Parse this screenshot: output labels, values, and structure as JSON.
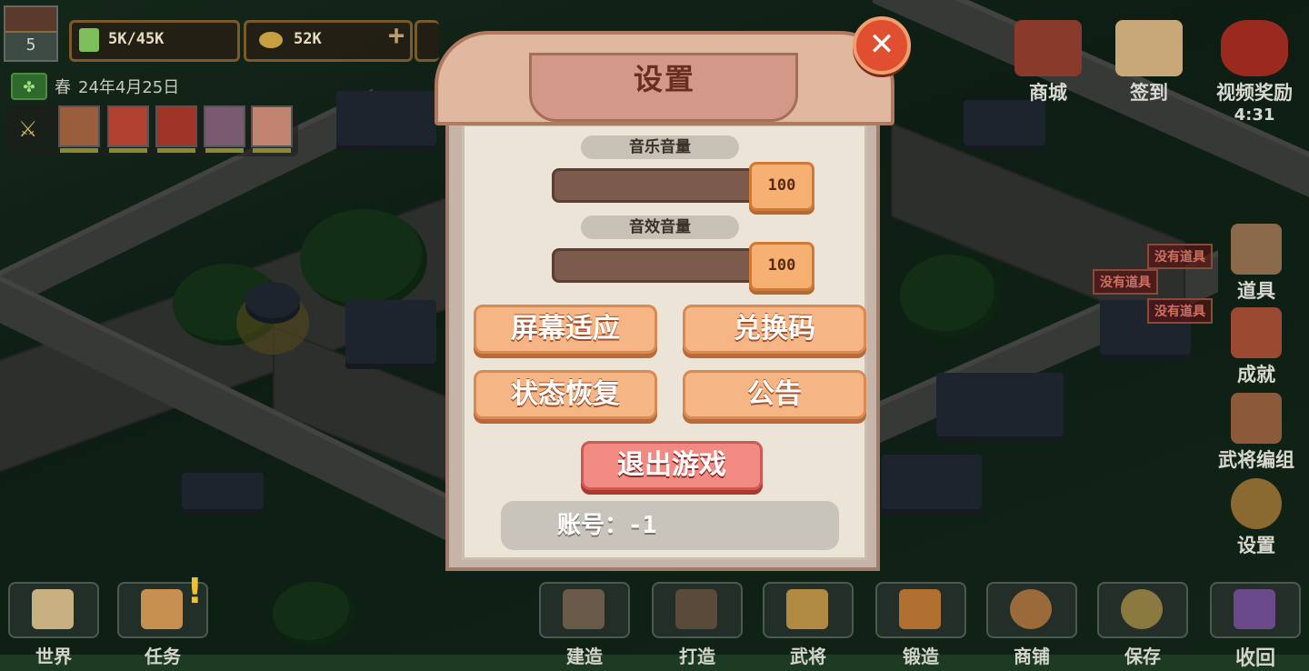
{
  "hud": {
    "level": "5",
    "population_icon": "person-icon",
    "population": "5K/45K",
    "coins": "52K",
    "season": "春",
    "date": "24年4月25日"
  },
  "right_menu": {
    "shop": "商城",
    "checkin": "签到",
    "video_reward": "视频奖励",
    "video_timer": "4:31",
    "items": "道具",
    "achievements": "成就",
    "general_formation": "武将编组",
    "settings": "设置",
    "warnings": [
      "没有道具",
      "没有道具",
      "没有道具"
    ]
  },
  "bottom_bar": {
    "items": [
      "世界",
      "任务",
      "建造",
      "打造",
      "武将",
      "锻造",
      "商铺",
      "保存",
      "收回"
    ]
  },
  "dialog": {
    "title": "设置",
    "music_volume_label": "音乐音量",
    "music_volume": 100,
    "sfx_volume_label": "音效音量",
    "sfx_volume": 100,
    "screen_fit": "屏幕适应",
    "redeem_code": "兑换码",
    "state_recovery": "状态恢复",
    "announcement": "公告",
    "exit_game": "退出游戏",
    "account_label": "账号：",
    "account_value": "-1"
  },
  "colors": {
    "dialog_frame": "#e0b8a0",
    "orange_button": "#f6b584",
    "red_button": "#f08a82",
    "close_button": "#e05030"
  }
}
